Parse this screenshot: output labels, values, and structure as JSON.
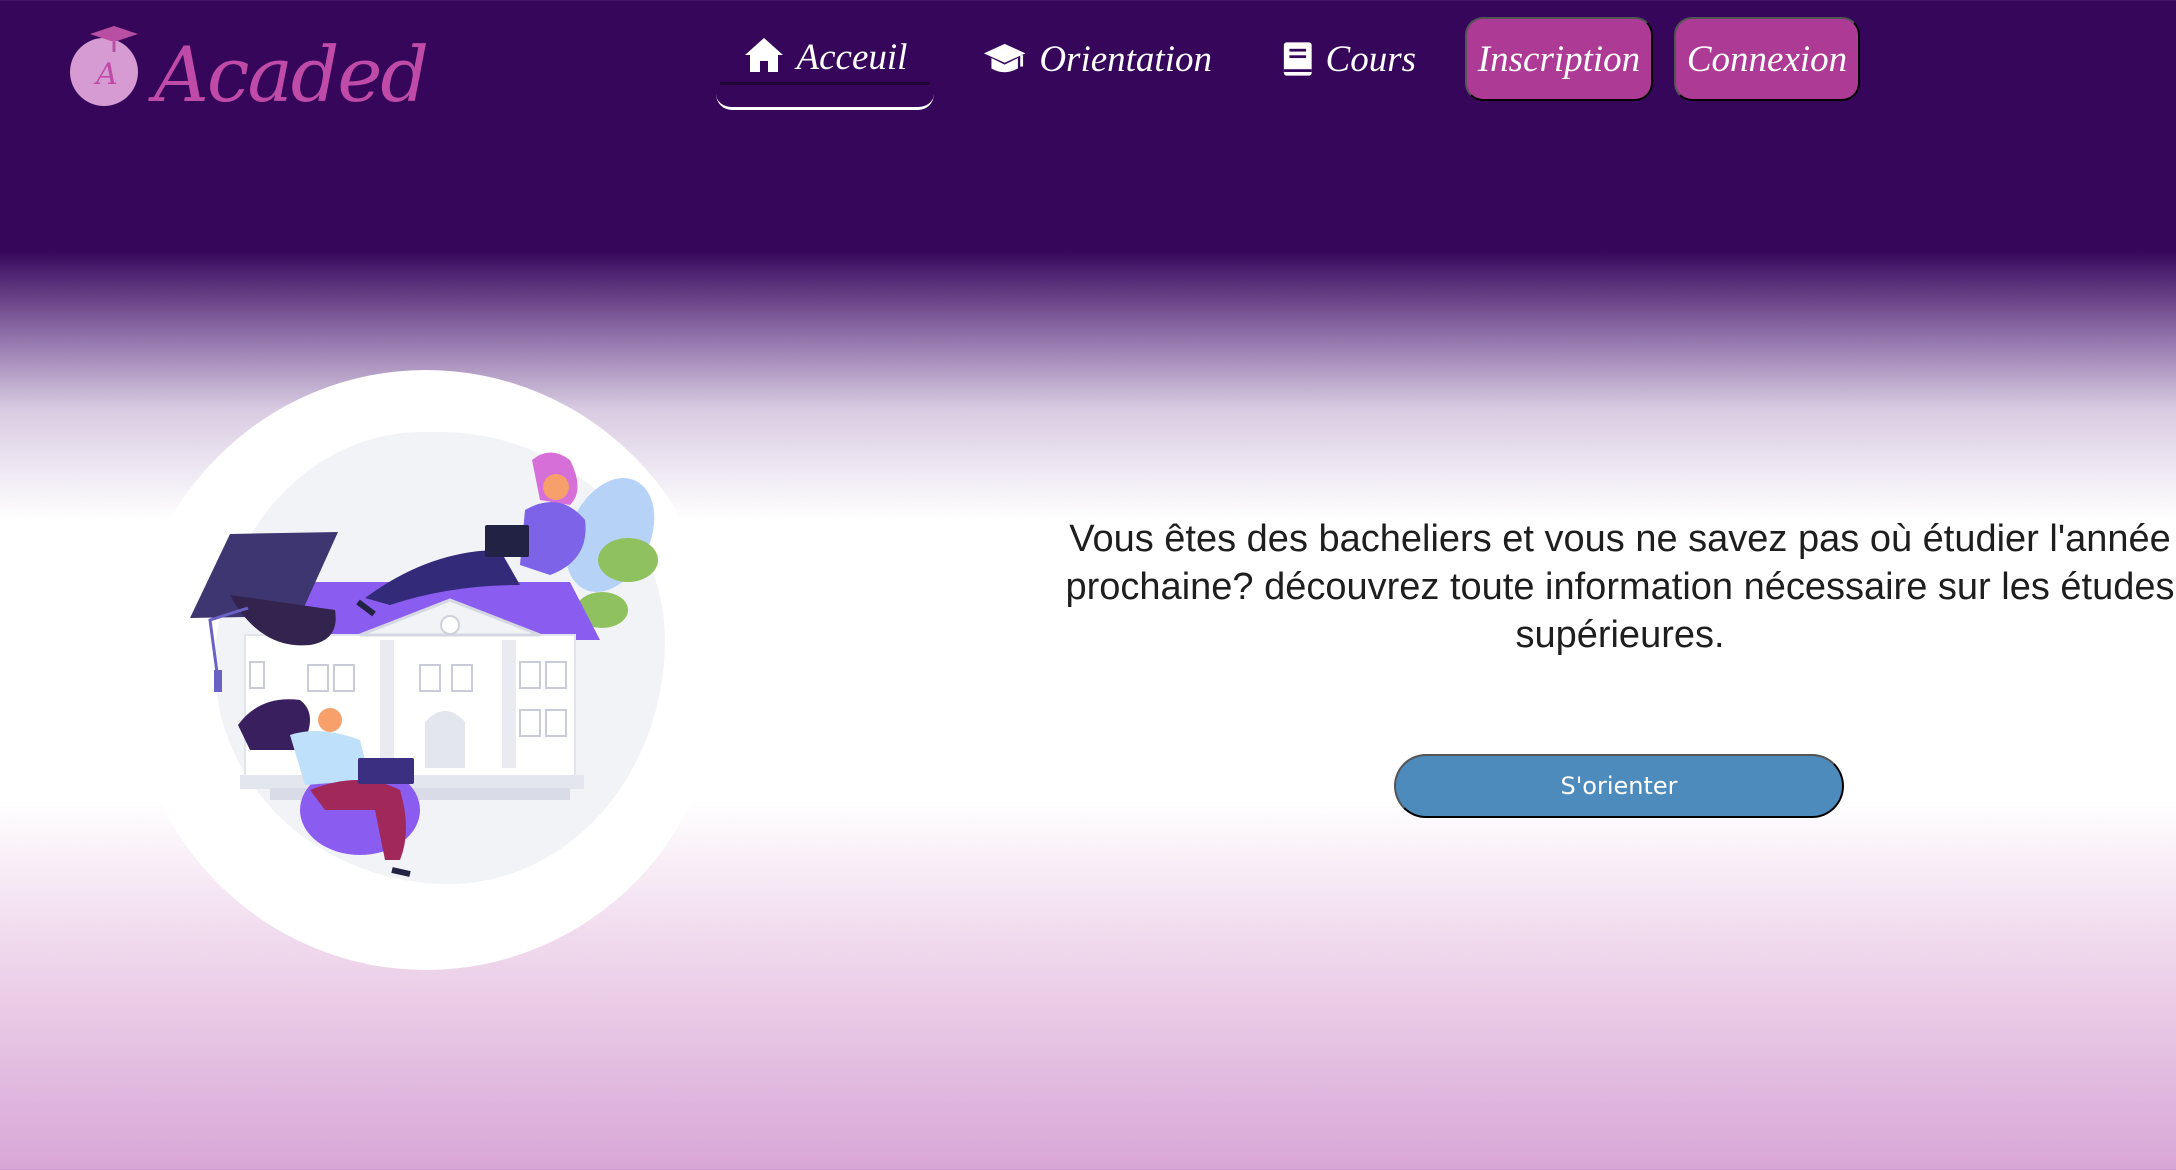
{
  "brand": {
    "name": "Acaded",
    "logo_letter": "A"
  },
  "nav": {
    "items": [
      {
        "label": "Acceuil",
        "icon": "home-icon",
        "active": true
      },
      {
        "label": "Orientation",
        "icon": "graduation-cap-icon",
        "active": false
      },
      {
        "label": "Cours",
        "icon": "book-icon",
        "active": false
      }
    ],
    "buttons": [
      {
        "label": "Inscription"
      },
      {
        "label": "Connexion"
      }
    ]
  },
  "hero": {
    "text": "Vous êtes des bacheliers et vous ne savez pas où étudier l'année prochaine? découvrez toute information nécessaire sur les études supérieures.",
    "cta_label": "S'orienter",
    "illustration": "students-university-illustration"
  },
  "colors": {
    "header_bg": "#35065a",
    "button_accent": "#ad3a95",
    "cta": "#4e8bbd",
    "logo": "#c04aa8"
  }
}
